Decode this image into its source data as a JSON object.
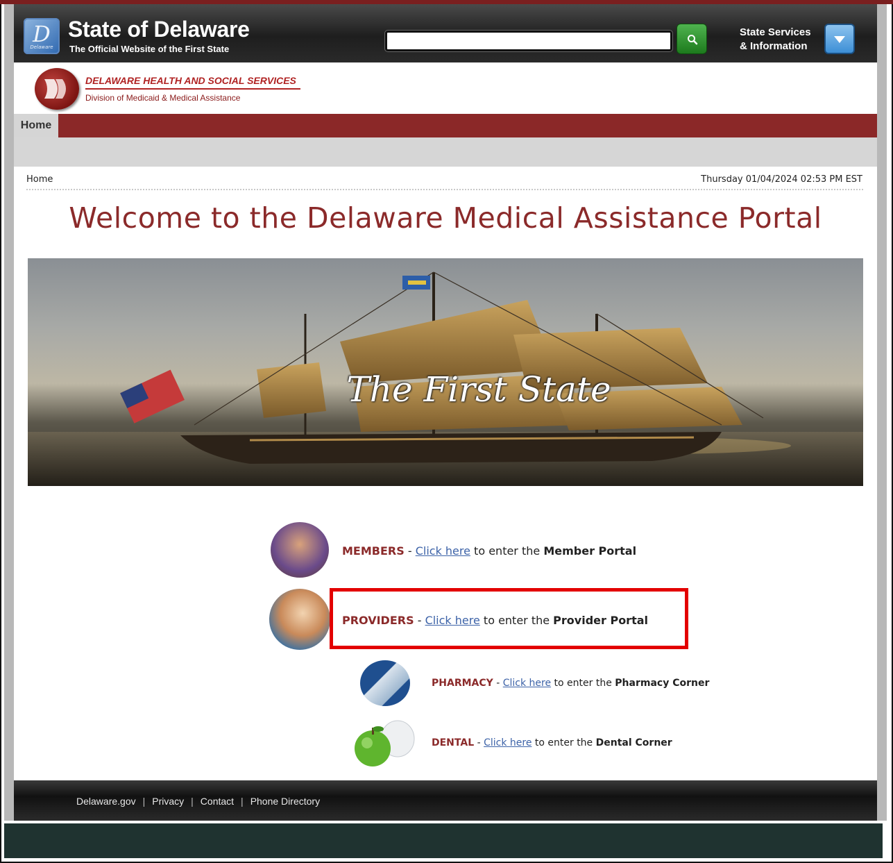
{
  "header": {
    "logo_text": "D",
    "logo_small": "Delaware",
    "title": "State of Delaware",
    "subtitle": "The Official Website of the First State",
    "search_value": "",
    "state_services_line1": "State Services",
    "state_services_line2": "& Information"
  },
  "dhss": {
    "title": "DELAWARE HEALTH AND SOCIAL SERVICES",
    "subtitle": "Division of Medicaid & Medical Assistance"
  },
  "nav": {
    "home": "Home"
  },
  "breadcrumb": "Home",
  "datetime": "Thursday 01/04/2024 02:53 PM EST",
  "welcome": "Welcome to the Delaware Medical Assistance Portal",
  "hero_text": "The First State",
  "portals": [
    {
      "kind": "MEMBERS",
      "dash": " - ",
      "link": "Click here",
      "middle": " to enter the ",
      "target": "Member Portal"
    },
    {
      "kind": "PROVIDERS",
      "dash": " - ",
      "link": "Click here",
      "middle": " to enter the ",
      "target": "Provider Portal"
    },
    {
      "kind": "PHARMACY",
      "dash": " - ",
      "link": "Click here",
      "middle": " to enter the ",
      "target": "Pharmacy Corner"
    },
    {
      "kind": "DENTAL",
      "dash": " - ",
      "link": "Click here",
      "middle": " to enter the ",
      "target": "Dental Corner"
    }
  ],
  "footer": {
    "links": [
      "Delaware.gov",
      "Privacy",
      "Contact",
      "Phone Directory"
    ],
    "separator": "|"
  },
  "colors": {
    "brand_red": "#8b2828",
    "highlight_red": "#e30000",
    "link_blue": "#3d63a8",
    "search_green": "#1d7a1d"
  },
  "icons": [
    "delaware-logo-icon",
    "search-icon",
    "chevron-down-icon",
    "dhss-logo-icon"
  ]
}
